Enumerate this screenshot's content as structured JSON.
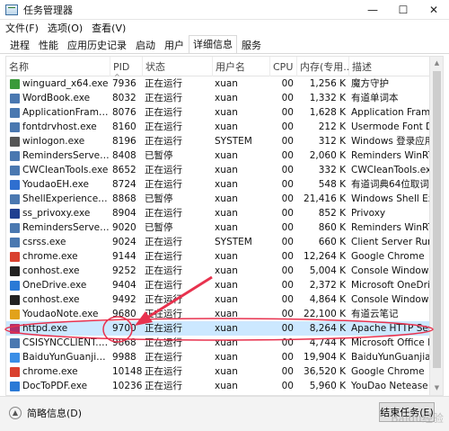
{
  "window": {
    "title": "任务管理器",
    "controls": {
      "minimize": "—",
      "maximize": "☐",
      "close": "✕"
    }
  },
  "menu": [
    "文件(F)",
    "选项(O)",
    "查看(V)"
  ],
  "tabs": [
    "进程",
    "性能",
    "应用历史记录",
    "启动",
    "用户",
    "详细信息",
    "服务"
  ],
  "active_tab": "详细信息",
  "columns": [
    "名称",
    "PID",
    "状态",
    "用户名",
    "CPU",
    "内存(专用...",
    "描述"
  ],
  "rows": [
    {
      "name": "winguard_x64.exe",
      "pid": "7936",
      "status": "正在运行",
      "user": "xuan",
      "cpu": "00",
      "mem": "1,256 K",
      "desc": "魔方守护",
      "icon": "shield-icon",
      "color": "#3a9a3a"
    },
    {
      "name": "WordBook.exe",
      "pid": "8032",
      "status": "正在运行",
      "user": "xuan",
      "cpu": "00",
      "mem": "1,332 K",
      "desc": "有道单词本",
      "icon": "window-icon",
      "color": "#4a78b0"
    },
    {
      "name": "ApplicationFrameHo...",
      "pid": "8076",
      "status": "正在运行",
      "user": "xuan",
      "cpu": "00",
      "mem": "1,628 K",
      "desc": "Application Frame...",
      "icon": "window-icon",
      "color": "#4a78b0"
    },
    {
      "name": "fontdrvhost.exe",
      "pid": "8160",
      "status": "正在运行",
      "user": "xuan",
      "cpu": "00",
      "mem": "212 K",
      "desc": "Usermode Font Dr...",
      "icon": "window-icon",
      "color": "#4a78b0"
    },
    {
      "name": "winlogon.exe",
      "pid": "8196",
      "status": "正在运行",
      "user": "SYSTEM",
      "cpu": "00",
      "mem": "312 K",
      "desc": "Windows 登录应用...",
      "icon": "gear-icon",
      "color": "#555555"
    },
    {
      "name": "RemindersServer.exe",
      "pid": "8408",
      "status": "已暂停",
      "user": "xuan",
      "cpu": "00",
      "mem": "2,060 K",
      "desc": "Reminders WinRT ...",
      "icon": "window-icon",
      "color": "#4a78b0"
    },
    {
      "name": "CWCleanTools.exe",
      "pid": "8652",
      "status": "正在运行",
      "user": "xuan",
      "cpu": "00",
      "mem": "332 K",
      "desc": "CWCleanTools.exe",
      "icon": "window-icon",
      "color": "#4a78b0"
    },
    {
      "name": "YoudaoEH.exe",
      "pid": "8724",
      "status": "正在运行",
      "user": "xuan",
      "cpu": "00",
      "mem": "548 K",
      "desc": "有道词典64位取词...",
      "icon": "youdao-icon",
      "color": "#2f6fd0"
    },
    {
      "name": "ShellExperienceHo...",
      "pid": "8868",
      "status": "已暂停",
      "user": "xuan",
      "cpu": "00",
      "mem": "21,416 K",
      "desc": "Windows Shell Ex...",
      "icon": "window-icon",
      "color": "#4a78b0"
    },
    {
      "name": "ss_privoxy.exe",
      "pid": "8904",
      "status": "正在运行",
      "user": "xuan",
      "cpu": "00",
      "mem": "852 K",
      "desc": "Privoxy",
      "icon": "privoxy-icon",
      "color": "#1f3f90"
    },
    {
      "name": "RemindersServer.e...",
      "pid": "9020",
      "status": "已暂停",
      "user": "xuan",
      "cpu": "00",
      "mem": "860 K",
      "desc": "Reminders WinRT ...",
      "icon": "window-icon",
      "color": "#4a78b0"
    },
    {
      "name": "csrss.exe",
      "pid": "9024",
      "status": "正在运行",
      "user": "SYSTEM",
      "cpu": "00",
      "mem": "660 K",
      "desc": "Client Server Runti...",
      "icon": "window-icon",
      "color": "#4a78b0"
    },
    {
      "name": "chrome.exe",
      "pid": "9144",
      "status": "正在运行",
      "user": "xuan",
      "cpu": "00",
      "mem": "12,264 K",
      "desc": "Google Chrome",
      "icon": "chrome-icon",
      "color": "#d9412f"
    },
    {
      "name": "conhost.exe",
      "pid": "9252",
      "status": "正在运行",
      "user": "xuan",
      "cpu": "00",
      "mem": "5,004 K",
      "desc": "Console Window H...",
      "icon": "console-icon",
      "color": "#222222"
    },
    {
      "name": "OneDrive.exe",
      "pid": "9404",
      "status": "正在运行",
      "user": "xuan",
      "cpu": "00",
      "mem": "2,372 K",
      "desc": "Microsoft OneDrive",
      "icon": "cloud-icon",
      "color": "#2a7ad6"
    },
    {
      "name": "conhost.exe",
      "pid": "9492",
      "status": "正在运行",
      "user": "xuan",
      "cpu": "00",
      "mem": "4,864 K",
      "desc": "Console Window H...",
      "icon": "console-icon",
      "color": "#222222"
    },
    {
      "name": "YoudaoNote.exe",
      "pid": "9680",
      "status": "正在运行",
      "user": "xuan",
      "cpu": "00",
      "mem": "22,100 K",
      "desc": "有道云笔记",
      "icon": "note-icon",
      "color": "#e2a21b"
    },
    {
      "name": "httpd.exe",
      "pid": "9700",
      "status": "正在运行",
      "user": "xuan",
      "cpu": "00",
      "mem": "8,264 K",
      "desc": "Apache HTTP Serv...",
      "icon": "feather-icon",
      "color": "#b0306a",
      "selected": true
    },
    {
      "name": "CSISYNCCLIENT.EXE",
      "pid": "9868",
      "status": "正在运行",
      "user": "xuan",
      "cpu": "00",
      "mem": "4,744 K",
      "desc": "Microsoft Office D...",
      "icon": "window-icon",
      "color": "#4a78b0"
    },
    {
      "name": "BaiduYunGuanjia.e...",
      "pid": "9988",
      "status": "正在运行",
      "user": "xuan",
      "cpu": "00",
      "mem": "19,904 K",
      "desc": "BaiduYunGuanjia",
      "icon": "baidu-cloud-icon",
      "color": "#3a8ee6"
    },
    {
      "name": "chrome.exe",
      "pid": "10148",
      "status": "正在运行",
      "user": "xuan",
      "cpu": "00",
      "mem": "36,520 K",
      "desc": "Google Chrome",
      "icon": "chrome-icon",
      "color": "#d9412f"
    },
    {
      "name": "DocToPDF.exe",
      "pid": "10236",
      "status": "正在运行",
      "user": "xuan",
      "cpu": "00",
      "mem": "5,960 K",
      "desc": "YouDao Netease",
      "icon": "pdf-icon",
      "color": "#2a7ad6"
    }
  ],
  "footer": {
    "fewer_details": "简略信息(D)",
    "end_task": "结束任务(E)"
  },
  "annotation": {
    "color": "#e8324e"
  },
  "watermark": "Baidu经验"
}
